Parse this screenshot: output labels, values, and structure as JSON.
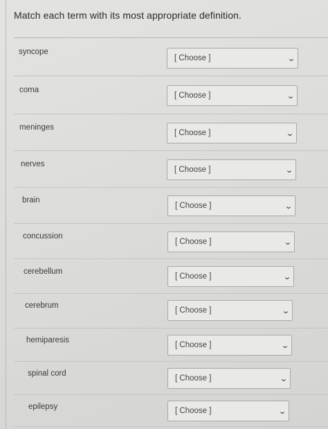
{
  "question": {
    "title": "Match each term with its most appropriate definition."
  },
  "rows": [
    {
      "term": "syncope",
      "choice": "[ Choose ]"
    },
    {
      "term": "coma",
      "choice": "[ Choose ]"
    },
    {
      "term": "meninges",
      "choice": "[ Choose ]"
    },
    {
      "term": "nerves",
      "choice": "[ Choose ]"
    },
    {
      "term": "brain",
      "choice": "[ Choose ]"
    },
    {
      "term": "concussion",
      "choice": "[ Choose ]"
    },
    {
      "term": "cerebellum",
      "choice": "[ Choose ]"
    },
    {
      "term": "cerebrum",
      "choice": "[ Choose ]"
    },
    {
      "term": "hemiparesis",
      "choice": "[ Choose ]"
    },
    {
      "term": "spinal cord",
      "choice": "[ Choose ]"
    },
    {
      "term": "epilepsy",
      "choice": "[ Choose ]"
    }
  ],
  "icons": {
    "dropdown": "chevron-down-icon"
  }
}
